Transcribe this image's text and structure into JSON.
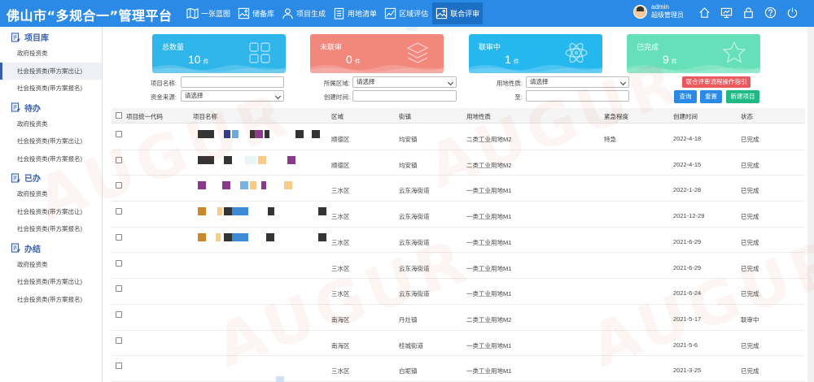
{
  "app_title": "佛山市“多规合一”管理平台",
  "nav": [
    {
      "label": "一张蓝图",
      "icon": "map-icon"
    },
    {
      "label": "储备库",
      "icon": "image-library-icon"
    },
    {
      "label": "项目生成",
      "icon": "user-icon"
    },
    {
      "label": "用地清单",
      "icon": "clipboard-list-icon"
    },
    {
      "label": "区域评估",
      "icon": "chart-icon"
    },
    {
      "label": "联合评审",
      "icon": "image-check-icon"
    }
  ],
  "user": {
    "name": "admin",
    "role": "超级管理员"
  },
  "top_icons": [
    "home-icon",
    "monitor-icon",
    "lock-icon",
    "help-icon",
    "power-icon"
  ],
  "sidebar": {
    "sections": [
      {
        "title": "项目库",
        "icon": "document-icon",
        "items": [
          "政府投资类",
          "社会投资类(带方案出让)",
          "社会投资类(带方案报名)"
        ]
      },
      {
        "title": "待办",
        "icon": "document-icon",
        "items": [
          "政府投资类",
          "社会投资类(带方案出让)",
          "社会投资类(带方案报名)"
        ]
      },
      {
        "title": "已办",
        "icon": "document-icon",
        "items": [
          "政府投资类",
          "社会投资类(带方案出让)",
          "社会投资类(带方案报名)"
        ]
      },
      {
        "title": "办结",
        "icon": "document-icon",
        "items": [
          "政府投资类",
          "社会投资类(带方案出让)",
          "社会投资类(带方案报名)"
        ]
      }
    ],
    "active_item": "社会投资类(带方案出让)"
  },
  "stats": [
    {
      "label": "总数量",
      "value": "10",
      "unit": "件",
      "color": "#2eb5ea",
      "icon": "grid-icon"
    },
    {
      "label": "未联审",
      "value": "0",
      "unit": "件",
      "color": "#f2877c",
      "icon": "layers-icon"
    },
    {
      "label": "联审中",
      "value": "1",
      "unit": "件",
      "color": "#25b8ee",
      "icon": "atom-icon"
    },
    {
      "label": "已完成",
      "value": "9",
      "unit": "件",
      "color": "#66e0b8",
      "icon": "star-icon"
    }
  ],
  "filters": {
    "project_name_label": "项目名称:",
    "project_name_value": "",
    "funding_label": "资金来源:",
    "funding_value": "请选择",
    "district_label": "所属区域:",
    "district_value": "请选择",
    "created_label": "创建时间:",
    "created_value": "",
    "land_use_label": "用地性质:",
    "land_use_value": "请选择",
    "to_label": "至:",
    "to_value": ""
  },
  "buttons": {
    "guide": "联合评审流程操作指引",
    "search": "查询",
    "reset": "重置",
    "new": "新建项目"
  },
  "table": {
    "columns": [
      "项目统一代码",
      "项目名称",
      "区域",
      "街镇",
      "用地性质",
      "紧急程度",
      "创建时间",
      "状态"
    ],
    "rows": [
      {
        "region": "顺德区",
        "town": "均安镇",
        "land": "二类工业用地M2",
        "urgency": "特急",
        "date": "2022-4-18",
        "status": "已完成"
      },
      {
        "region": "顺德区",
        "town": "均安镇",
        "land": "二类工业用地M2",
        "urgency": "",
        "date": "2022-4-15",
        "status": "已完成"
      },
      {
        "region": "三水区",
        "town": "云东海街道",
        "land": "一类工业用地M1",
        "urgency": "",
        "date": "2022-1-28",
        "status": "已完成"
      },
      {
        "region": "三水区",
        "town": "云东海街道",
        "land": "一类工业用地M1",
        "urgency": "",
        "date": "2021-12-29",
        "status": "已完成"
      },
      {
        "region": "三水区",
        "town": "云东海街道",
        "land": "一类工业用地M1",
        "urgency": "",
        "date": "2021-6-29",
        "status": "已完成"
      },
      {
        "region": "三水区",
        "town": "云东海街道",
        "land": "一类工业用地M1",
        "urgency": "",
        "date": "2021-6-29",
        "status": "已完成"
      },
      {
        "region": "三水区",
        "town": "云东海街道",
        "land": "一类工业用地M1",
        "urgency": "",
        "date": "2021-6-24",
        "status": "已完成"
      },
      {
        "region": "南海区",
        "town": "丹灶镇",
        "land": "二类工业用地M2",
        "urgency": "",
        "date": "2021-5-17",
        "status": "联审中"
      },
      {
        "region": "南海区",
        "town": "桂城街道",
        "land": "一类工业用地M1",
        "urgency": "",
        "date": "2021-5-6",
        "status": "已完成"
      },
      {
        "region": "三水区",
        "town": "白坭镇",
        "land": "一类工业用地M1",
        "urgency": "",
        "date": "2021-3-25",
        "status": "已完成"
      }
    ]
  },
  "watermark": "AUGUR"
}
